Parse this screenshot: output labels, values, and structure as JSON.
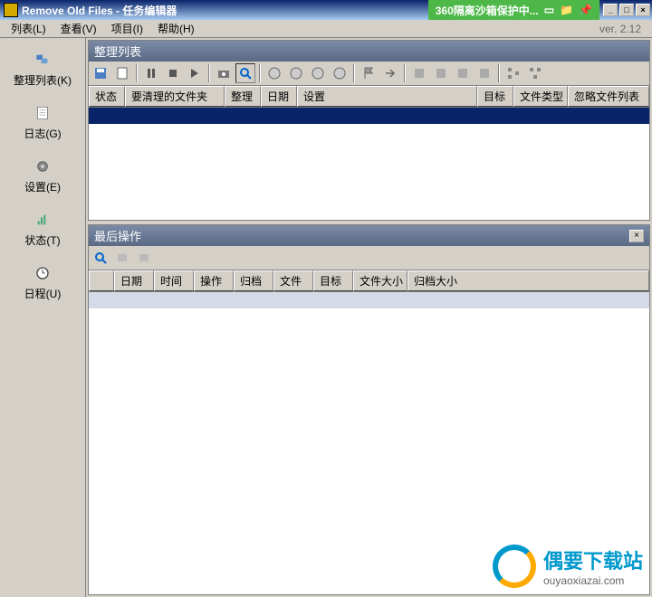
{
  "window": {
    "title": "Remove Old Files - 任务编辑器",
    "sandbox_badge": "360隔离沙箱保护中..."
  },
  "menu": {
    "list": "列表(L)",
    "view": "查看(V)",
    "project": "项目(I)",
    "help": "帮助(H)",
    "version": "ver. 2.12"
  },
  "sidebar": {
    "items": [
      {
        "label": "整理列表(K)"
      },
      {
        "label": "日志(G)"
      },
      {
        "label": "设置(E)"
      },
      {
        "label": "状态(T)"
      },
      {
        "label": "日程(U)"
      }
    ]
  },
  "panel_upper": {
    "title": "整理列表",
    "columns": {
      "status": "状态",
      "folder": "要清理的文件夹",
      "cleanup": "整理",
      "date": "日期",
      "settings": "设置",
      "target": "目标",
      "filetype": "文件类型",
      "ignore": "忽略文件列表"
    }
  },
  "panel_lower": {
    "title": "最后操作",
    "columns": {
      "date": "日期",
      "time": "时间",
      "operation": "操作",
      "archive": "归档",
      "file": "文件",
      "target": "目标",
      "filesize": "文件大小",
      "archivesize": "归档大小"
    }
  },
  "watermark": {
    "title": "偶要下载站",
    "url": "ouyaoxiazai.com"
  }
}
